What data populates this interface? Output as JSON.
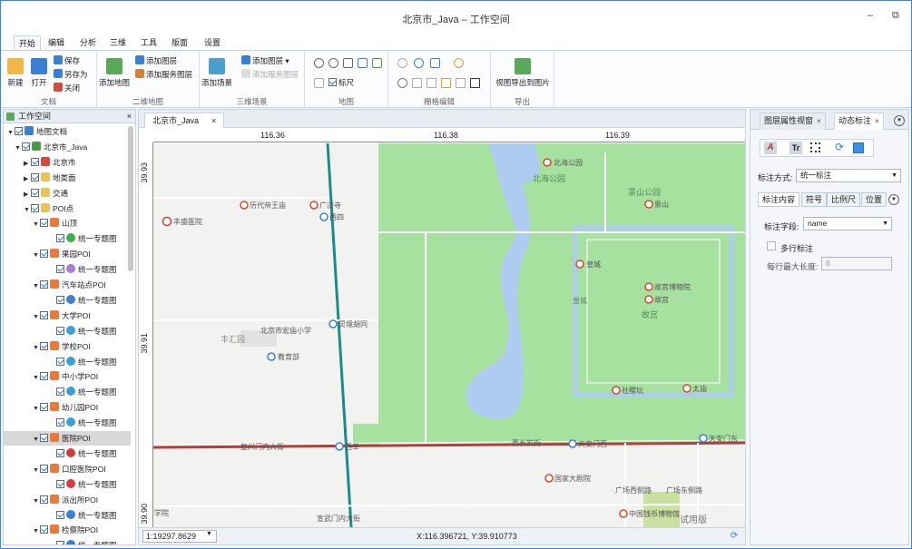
{
  "window": {
    "title": "北京市_Java – 工作空间",
    "minimize": "–",
    "restore": "⧉"
  },
  "menu": [
    "开始",
    "编辑",
    "分析",
    "三维",
    "工具",
    "版面",
    "设置"
  ],
  "ribbon": {
    "doc": {
      "new": "新建",
      "open": "打开",
      "save": "保存",
      "save_as": "另存为",
      "close": "关闭",
      "group": "文档"
    },
    "map2d": {
      "add_map": "添加地图",
      "add_layer": "添加图层",
      "add_service_layer": "添加服务图层",
      "group": "二维地图"
    },
    "scene3d": {
      "add_scene": "添加场景",
      "add_layer": "添加图层",
      "add_service_layer": "添加服务图层",
      "group": "三维场景"
    },
    "map": {
      "scale": "标尺",
      "group": "地图"
    },
    "raster": {
      "group": "栅格编辑"
    },
    "export": {
      "view_export": "视图导出到图片",
      "group": "导出"
    }
  },
  "workspace": {
    "title": "工作空间",
    "tree": [
      {
        "label": "地图文档",
        "level": 0,
        "arrow": "▼",
        "color": "#3b7fd4"
      },
      {
        "label": "北京市_Java",
        "level": 1,
        "arrow": "▼",
        "color": "#4a9a4a"
      },
      {
        "label": "北京市",
        "level": 2,
        "arrow": "▶",
        "color": "#d44a3b"
      },
      {
        "label": "地类面",
        "level": 2,
        "arrow": "▶",
        "color": "#e8c25a"
      },
      {
        "label": "交通",
        "level": 2,
        "arrow": "▶",
        "color": "#e8c25a"
      },
      {
        "label": "POI点",
        "level": 2,
        "arrow": "▼",
        "color": "#e8c25a"
      },
      {
        "label": "山顶",
        "level": 3,
        "arrow": "▼",
        "color": "#e87a3b"
      },
      {
        "label": "统一专题图",
        "level": 4,
        "arrow": "",
        "color": "#3bb04a"
      },
      {
        "label": "果园POI",
        "level": 3,
        "arrow": "▼",
        "color": "#e87a3b"
      },
      {
        "label": "统一专题图",
        "level": 4,
        "arrow": "",
        "color": "#b07ad4"
      },
      {
        "label": "汽车站点POI",
        "level": 3,
        "arrow": "▼",
        "color": "#e87a3b"
      },
      {
        "label": "统一专题图",
        "level": 4,
        "arrow": "",
        "color": "#3b7fd4"
      },
      {
        "label": "大学POI",
        "level": 3,
        "arrow": "▼",
        "color": "#e87a3b"
      },
      {
        "label": "统一专题图",
        "level": 4,
        "arrow": "",
        "color": "#3ba0d4"
      },
      {
        "label": "学校POI",
        "level": 3,
        "arrow": "▼",
        "color": "#e87a3b"
      },
      {
        "label": "统一专题图",
        "level": 4,
        "arrow": "",
        "color": "#3ba0d4"
      },
      {
        "label": "中小学POI",
        "level": 3,
        "arrow": "▼",
        "color": "#e87a3b"
      },
      {
        "label": "统一专题图",
        "level": 4,
        "arrow": "",
        "color": "#3ba0d4"
      },
      {
        "label": "幼儿园POI",
        "level": 3,
        "arrow": "▼",
        "color": "#e87a3b"
      },
      {
        "label": "统一专题图",
        "level": 4,
        "arrow": "",
        "color": "#3ba0d4"
      },
      {
        "label": "医院POI",
        "level": 3,
        "arrow": "▼",
        "color": "#e87a3b",
        "selected": true
      },
      {
        "label": "统一专题图",
        "level": 4,
        "arrow": "",
        "color": "#d43b3b"
      },
      {
        "label": "口腔医院POI",
        "level": 3,
        "arrow": "▼",
        "color": "#e87a3b"
      },
      {
        "label": "统一专题图",
        "level": 4,
        "arrow": "",
        "color": "#d43b3b"
      },
      {
        "label": "派出所POI",
        "level": 3,
        "arrow": "▼",
        "color": "#e87a3b"
      },
      {
        "label": "统一专题图",
        "level": 4,
        "arrow": "",
        "color": "#3b7fd4"
      },
      {
        "label": "检察院POI",
        "level": 3,
        "arrow": "▼",
        "color": "#e87a3b"
      },
      {
        "label": "统一专题图",
        "level": 4,
        "arrow": "",
        "color": "#3b7fd4"
      }
    ]
  },
  "map_tab": {
    "label": "北京市_Java",
    "close": "×"
  },
  "rulers": {
    "top": [
      "116.36",
      "116.38",
      "116.39"
    ],
    "left": [
      "39.93",
      "39.91",
      "39.90"
    ]
  },
  "map_labels": {
    "beihai": "北海公园",
    "beihai_poi": "北海公园",
    "jingshan": "景山公园",
    "jingshan_poi": "景山",
    "lidai": "历代帝王庙",
    "guangji": "广济寺",
    "xisi": "西四",
    "fengsheng": "丰盛医院",
    "huangcheng": "皇城",
    "huangcheng2": "皇城",
    "gugong_museum": "故宫博物院",
    "gugong_poi": "故宫",
    "gugong": "故宫",
    "lingjing": "灵境胡同",
    "school": "北京市宏庙小学",
    "fenghui": "丰汇园",
    "jiaoyu": "教育部",
    "shejitan": "社稷坛",
    "taimiao": "太庙",
    "xidan": "西单",
    "xichangan": "西长安街",
    "tiananmen_w": "天安门西",
    "tiananmen_e": "天安门东",
    "fuxingmen": "复兴门内大街",
    "dajuyuan": "国家大剧院",
    "guangchang_w": "广场西侧路",
    "guangchang_e": "广场东侧路",
    "qianbi": "中国钱币博物馆",
    "xuanwu": "宣武门内大街",
    "xueyuan": "学院",
    "trial": "试用版"
  },
  "status": {
    "scale": "1:19297.8629",
    "coords": "X:116.396721, Y:39.910773"
  },
  "props": {
    "tab1": "图层属性视窗",
    "tab2": "动态标注",
    "mode_label": "标注方式:",
    "mode_value": "统一标注",
    "sub_tabs": [
      "标注内容",
      "符号",
      "比例尺",
      "位置"
    ],
    "field_label": "标注字段:",
    "field_value": "name",
    "multiline": "多行标注",
    "maxlen_label": "每行最大长度:",
    "maxlen_value": "6"
  }
}
